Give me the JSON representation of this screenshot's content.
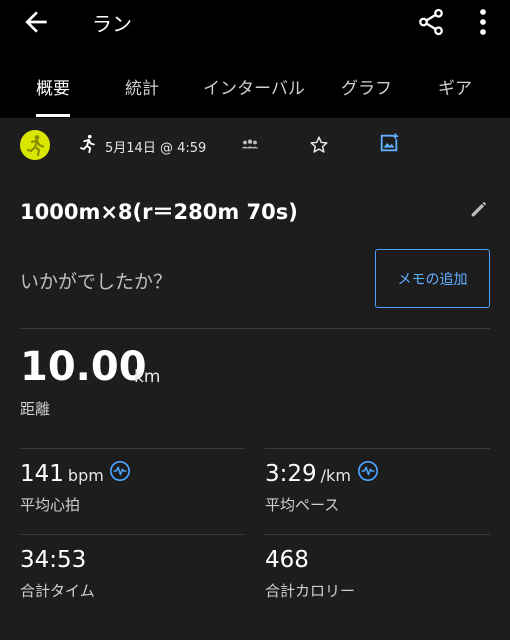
{
  "header": {
    "title": "ラン",
    "back_icon": "arrow-left-icon",
    "share_icon": "share-icon",
    "more_icon": "more-vert-icon"
  },
  "tabs": [
    {
      "label": "概要",
      "active": true
    },
    {
      "label": "統計",
      "active": false
    },
    {
      "label": "インターバル",
      "active": false
    },
    {
      "label": "グラフ",
      "active": false
    },
    {
      "label": "ギア",
      "active": false
    }
  ],
  "summary": {
    "date": "5月14日 @ 4:59"
  },
  "activity": {
    "name": "1000m×8(r＝280m 70s)"
  },
  "feedback": {
    "question": "いかがでしたか？",
    "memo_button": "メモの追加"
  },
  "distance": {
    "value": "10.00",
    "unit": "km",
    "label": "距離"
  },
  "stats": [
    {
      "value": "141",
      "unit": "bpm",
      "label": "平均心拍"
    },
    {
      "value": "3:29",
      "unit": "/km",
      "label": "平均ペース"
    },
    {
      "value": "34:53",
      "unit": "",
      "label": "合計タイム"
    },
    {
      "value": "468",
      "unit": "",
      "label": "合計カロリー"
    }
  ],
  "colors": {
    "background": "#1d1d1d",
    "appbar": "#000000",
    "accent_blue": "#4da3ff",
    "avatar_yellow": "#d8e600"
  }
}
